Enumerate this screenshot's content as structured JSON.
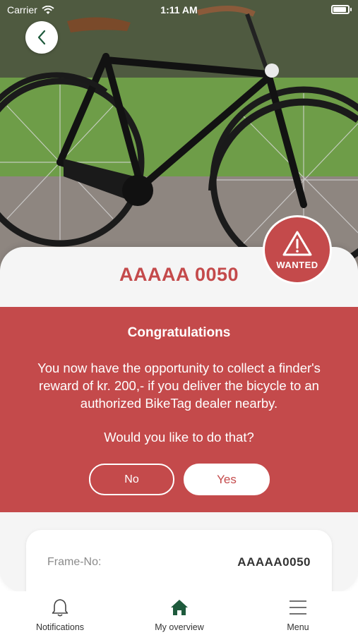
{
  "status_bar": {
    "carrier": "Carrier",
    "time": "1:11 AM"
  },
  "bike": {
    "registration": "AAAAA 0050",
    "badge": "WANTED"
  },
  "reward_dialog": {
    "title": "Congratulations",
    "message": "You now have the opportunity to collect a finder's reward of kr. 200,- if you deliver the bicycle to an authorized BikeTag dealer nearby.",
    "question": "Would you like to do that?",
    "no_label": "No",
    "yes_label": "Yes"
  },
  "details": {
    "frame_label": "Frame-No:",
    "frame_value": "AAAAA0050"
  },
  "tabbar": {
    "items": [
      {
        "label": "Notifications",
        "icon": "bell-icon"
      },
      {
        "label": "My overview",
        "icon": "home-icon"
      },
      {
        "label": "Menu",
        "icon": "menu-icon"
      }
    ]
  },
  "colors": {
    "accent": "#c44a4b",
    "active_tab": "#1e5a3c",
    "card_bg": "#f5f5f5"
  }
}
